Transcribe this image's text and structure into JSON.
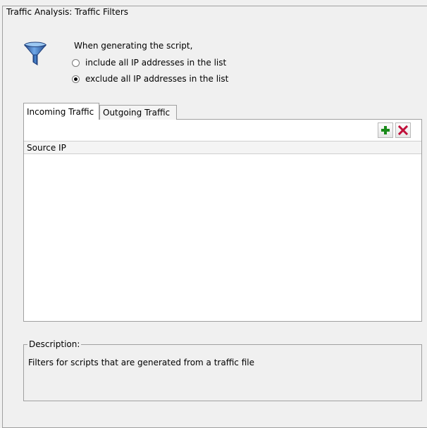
{
  "group": {
    "title": "Traffic Analysis: Traffic Filters"
  },
  "filter": {
    "icon": "funnel-icon",
    "intro": "When generating the script,",
    "options": [
      {
        "label": "include all IP addresses in the list",
        "checked": false
      },
      {
        "label": "exclude all IP addresses in the list",
        "checked": true
      }
    ]
  },
  "tabs": [
    {
      "label": "Incoming Traffic",
      "active": true
    },
    {
      "label": "Outgoing Traffic",
      "active": false
    }
  ],
  "toolbar": {
    "add_icon": "plus-icon",
    "remove_icon": "close-icon",
    "add_color": "#1a8a1a",
    "remove_color": "#c0103a"
  },
  "list": {
    "columns": [
      "Source IP"
    ],
    "rows": []
  },
  "description": {
    "title": "Description:",
    "text": "Filters for scripts that are generated from a traffic file"
  }
}
